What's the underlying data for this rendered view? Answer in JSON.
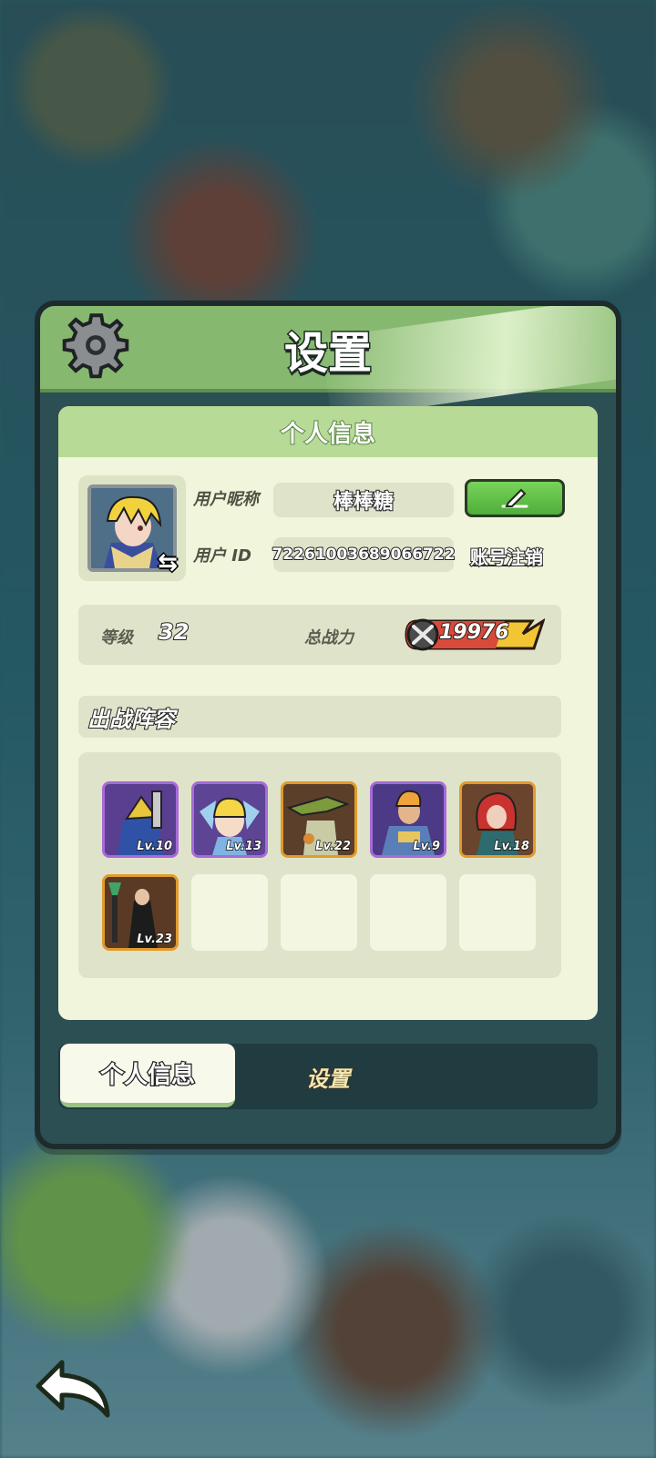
{
  "panel": {
    "title": "设置"
  },
  "profile": {
    "section_title": "个人信息",
    "nickname_label": "用户昵称",
    "nickname": "棒棒糖",
    "id_label": "用户 ID",
    "user_id": "72261003689066722",
    "logout_label": "账号注销"
  },
  "stats": {
    "level_label": "等级",
    "level": "32",
    "power_label": "总战力",
    "power": "19976"
  },
  "lineup": {
    "title": "出战阵容",
    "heroes": [
      {
        "level": "Lv.10",
        "rarity": "purple"
      },
      {
        "level": "Lv.13",
        "rarity": "purple"
      },
      {
        "level": "Lv.22",
        "rarity": "orange"
      },
      {
        "level": "Lv.9",
        "rarity": "purple"
      },
      {
        "level": "Lv.18",
        "rarity": "orange"
      },
      {
        "level": "Lv.23",
        "rarity": "orange"
      }
    ]
  },
  "tabs": {
    "active": "个人信息",
    "inactive": "设置"
  },
  "colors": {
    "header_green": "#86b96f",
    "card_bg": "#f0f5dc",
    "edit_green": "#4fae3a",
    "purple_rarity": "#a86ad9",
    "orange_rarity": "#e19b2c"
  }
}
